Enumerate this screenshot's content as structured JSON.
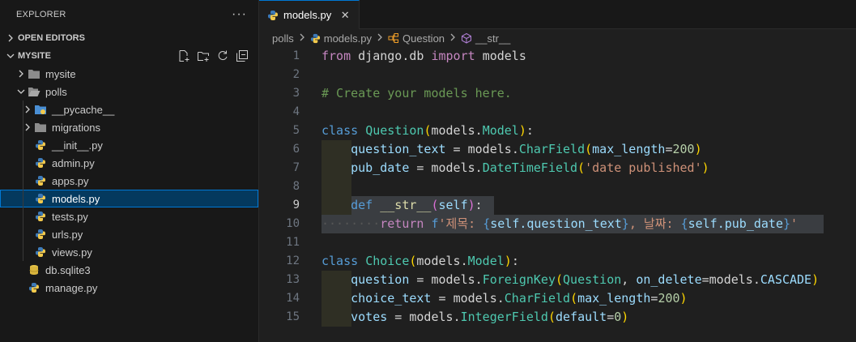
{
  "explorer": {
    "title": "EXPLORER",
    "more": "···",
    "open_editors": "OPEN EDITORS",
    "workspace": "MYSITE",
    "tree": [
      {
        "label": "mysite",
        "kind": "folder",
        "depth": 1,
        "expanded": false
      },
      {
        "label": "polls",
        "kind": "folder",
        "depth": 1,
        "expanded": true
      },
      {
        "label": "__pycache__",
        "kind": "folder-special",
        "depth": 2,
        "expanded": false
      },
      {
        "label": "migrations",
        "kind": "folder",
        "depth": 2,
        "expanded": false
      },
      {
        "label": "__init__.py",
        "kind": "python",
        "depth": 2
      },
      {
        "label": "admin.py",
        "kind": "python",
        "depth": 2
      },
      {
        "label": "apps.py",
        "kind": "python",
        "depth": 2
      },
      {
        "label": "models.py",
        "kind": "python",
        "depth": 2,
        "selected": true
      },
      {
        "label": "tests.py",
        "kind": "python",
        "depth": 2
      },
      {
        "label": "urls.py",
        "kind": "python",
        "depth": 2
      },
      {
        "label": "views.py",
        "kind": "python",
        "depth": 2
      },
      {
        "label": "db.sqlite3",
        "kind": "database",
        "depth": 1
      },
      {
        "label": "manage.py",
        "kind": "python",
        "depth": 1
      }
    ]
  },
  "editor": {
    "tab": {
      "label": "models.py",
      "close": "✕"
    },
    "breadcrumb": {
      "folder": "polls",
      "file": "models.py",
      "class": "Question",
      "method": "__str__"
    },
    "line_numbers": [
      "1",
      "2",
      "3",
      "4",
      "5",
      "6",
      "7",
      "8",
      "9",
      "10",
      "11",
      "12",
      "13",
      "14",
      "15"
    ],
    "active_line": "9",
    "code": {
      "l1": {
        "from": "from",
        "mod": "django.db",
        "import": "import",
        "name": "models"
      },
      "l3": {
        "comment": "# Create your models here."
      },
      "l5": {
        "class": "class",
        "name": "Question",
        "base_mod": "models",
        "base": "Model",
        "end": ":"
      },
      "l6": {
        "var": "question_text",
        "eq": " = ",
        "mod": "models",
        "fn": "CharField",
        "arg": "max_length",
        "val": "200"
      },
      "l7": {
        "var": "pub_date",
        "eq": " = ",
        "mod": "models",
        "fn": "DateTimeField",
        "str": "'date published'"
      },
      "l9": {
        "def": "def",
        "fn": "__str__",
        "arg": "self",
        "end": ":"
      },
      "l10": {
        "ret": "return",
        "f": "f",
        "s1": "'제목: ",
        "e1": "self.question_text",
        "s2": ", 날짜: ",
        "e2": "self.pub_date",
        "s3": "'"
      },
      "l12": {
        "class": "class",
        "name": "Choice",
        "base_mod": "models",
        "base": "Model",
        "end": ":"
      },
      "l13": {
        "var": "question",
        "eq": " = ",
        "mod": "models",
        "fn": "ForeignKey",
        "a1": "Question",
        "kw": "on_delete",
        "mod2": "models",
        "const": "CASCADE"
      },
      "l14": {
        "var": "choice_text",
        "eq": " = ",
        "mod": "models",
        "fn": "CharField",
        "arg": "max_length",
        "val": "200"
      },
      "l15": {
        "var": "votes",
        "eq": " = ",
        "mod": "models",
        "fn": "IntegerField",
        "arg": "default",
        "val": "0"
      }
    }
  }
}
